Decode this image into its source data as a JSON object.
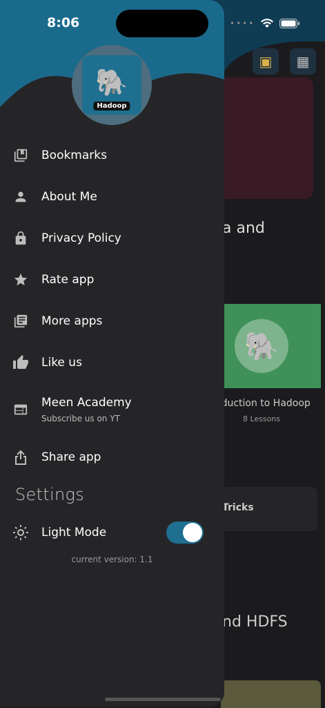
{
  "status_bar": {
    "time": "8:06"
  },
  "drawer": {
    "logo_label": "Hadoop",
    "menu_items": [
      {
        "label": "Bookmarks",
        "icon": "bookmarks-icon"
      },
      {
        "label": "About Me",
        "icon": "person-icon"
      },
      {
        "label": "Privacy Policy",
        "icon": "lock-icon"
      },
      {
        "label": "Rate app",
        "icon": "star-icon"
      },
      {
        "label": "More apps",
        "icon": "library-icon"
      },
      {
        "label": "Like us",
        "icon": "thumbs-up-icon"
      },
      {
        "label": "Meen Academy",
        "sublabel": "Subscribe us on YT",
        "icon": "web-window-icon"
      },
      {
        "label": "Share app",
        "icon": "share-icon"
      }
    ],
    "settings_heading": "Settings",
    "light_mode": {
      "label": "Light Mode",
      "enabled": true
    },
    "version": "current version: 1.1"
  },
  "background_app": {
    "title_fragment": "a and",
    "lesson_title": "oduction to Hadoop",
    "lesson_count": "8 Lessons",
    "tricks_label": "Tricks",
    "hdfs_label": "nd HDFS"
  },
  "colors": {
    "accent": "#1f6f90",
    "drawer_bg": "#252528",
    "header_bg": "#0f3b53"
  }
}
